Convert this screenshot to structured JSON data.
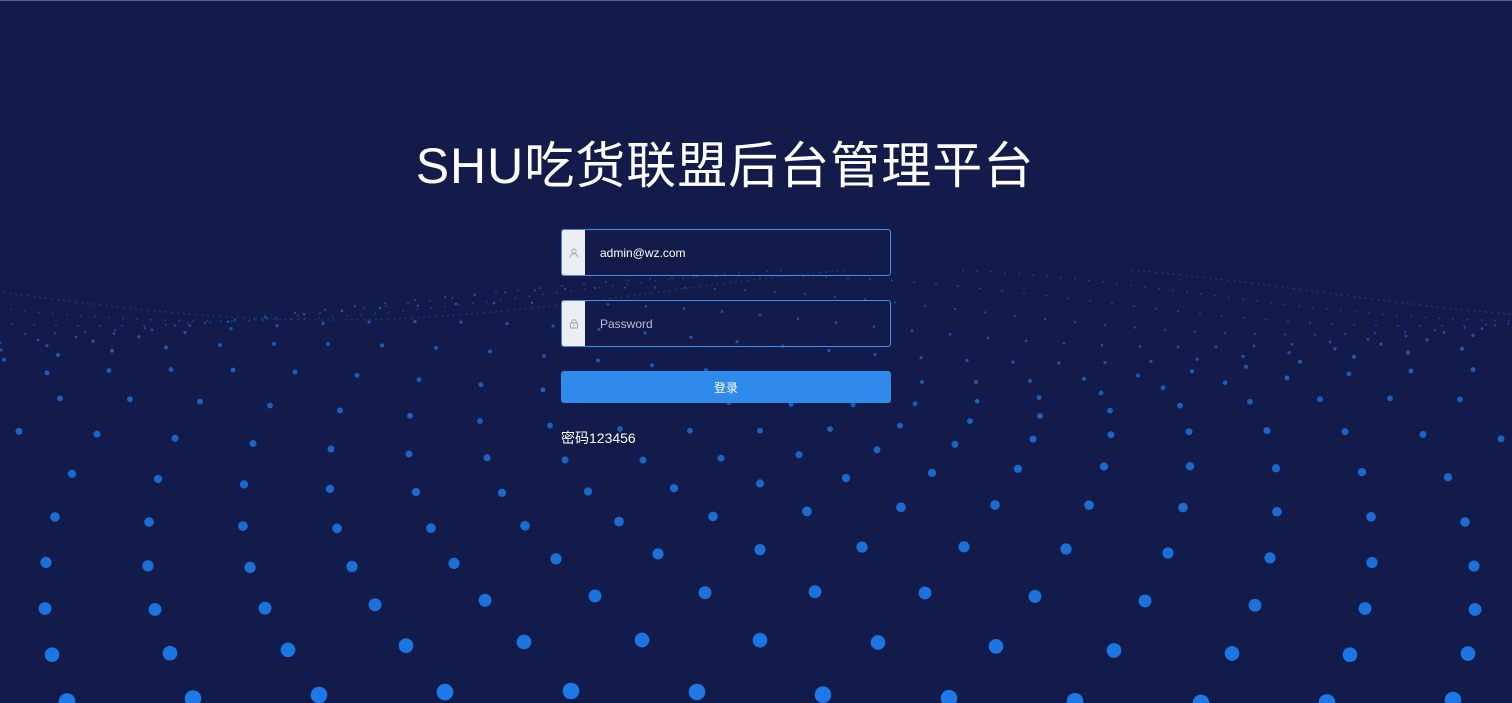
{
  "title": "SHU吃货联盟后台管理平台",
  "login_form": {
    "username": {
      "value": "admin@wz.com",
      "icon": "user-icon"
    },
    "password": {
      "placeholder": "Password",
      "icon": "lock-icon"
    },
    "submit_label": "登录",
    "hint": "密码123456"
  },
  "colors": {
    "background": "#131b4b",
    "accent": "#2e8bec",
    "dot": "#1b7ae8"
  }
}
